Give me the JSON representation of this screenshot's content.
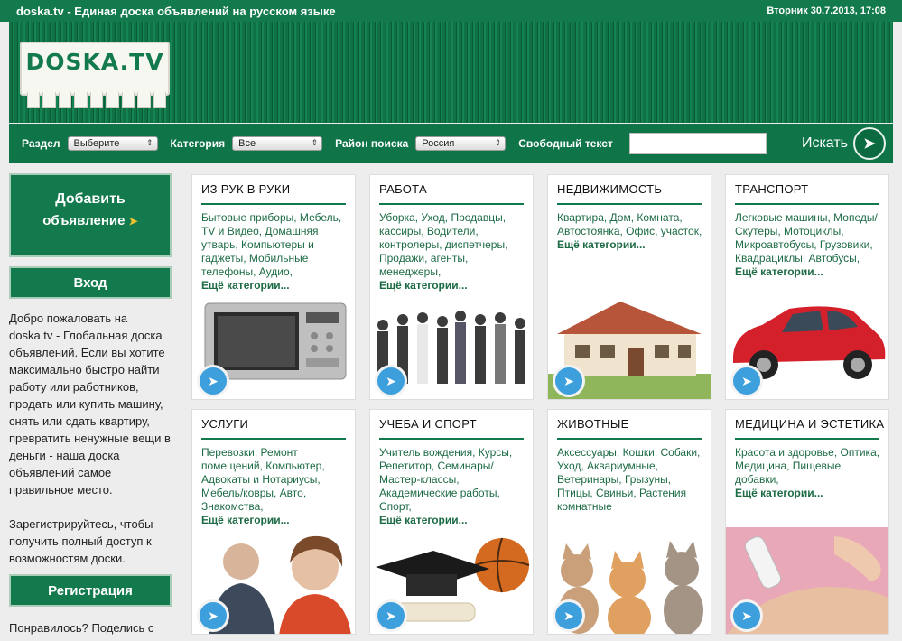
{
  "topbar": {
    "title": "doska.tv - Единая доска объявлений на русском языке",
    "datetime": "Вторник 30.7.2013, 17:08"
  },
  "logo": {
    "text": "DOSKA.TV"
  },
  "search": {
    "section_label": "Раздел",
    "section_value": "Выберите",
    "category_label": "Категория",
    "category_value": "Все",
    "region_label": "Район поиска",
    "region_value": "Россия",
    "freetext_label": "Свободный текст",
    "freetext_value": "",
    "button_label": "Искать"
  },
  "sidebar": {
    "add_line1": "Добавить",
    "add_line2": "объявление",
    "login_label": "Вход",
    "welcome_text": "Добро пожаловать на doska.tv - Глобальная доска объявлений. Если вы хотите максимально быстро найти работу или работников, продать или купить машину, снять или сдать квартиру, превратить ненужные вещи в деньги - наша доска объявлений самое правильное место.",
    "register_prompt": "Зарегистрируйтесь, чтобы получить полный доступ к возможностям доски.",
    "register_label": "Регистрация",
    "share_text": "Понравилось? Поделись с"
  },
  "cards": [
    {
      "title": "ИЗ РУК В РУКИ",
      "links": "Бытовые приборы, Мебель, TV и Видео, Домашняя утварь, Компьютеры и гаджеты, Мобильные телефоны, Аудио,",
      "more": "Ещё категории...",
      "image": "microwave"
    },
    {
      "title": "РАБОТА",
      "links": "Уборка, Уход, Продавцы, кассиры, Водители, контролеры, диспетчеры, Продажи, агенты, менеджеры,",
      "more": "Ещё категории...",
      "image": "people-group"
    },
    {
      "title": "НЕДВИЖИМОСТЬ",
      "links": "Квартира, Дом, Комната, Автостоянка, Офис, участок,",
      "more": "Ещё категории...",
      "image": "house"
    },
    {
      "title": "ТРАНСПОРТ",
      "links": "Легковые машины, Мопеды/Скутеры, Мотоциклы, Микроавтобусы, Грузовики, Квадрациклы, Автобусы,",
      "more": "Ещё категории...",
      "image": "red-car"
    },
    {
      "title": "УСЛУГИ",
      "links": "Перевозки, Ремонт помещений, Компьютер, Адвокаты и Нотариусы, Мебель/ковры, Авто, Знакомства,",
      "more": "Ещё категории...",
      "image": "call-center"
    },
    {
      "title": "УЧЕБА И СПОРТ",
      "links": "Учитель вождения, Курсы, Репетитор, Семинары/Мастер-классы, Академические работы, Спорт,",
      "more": "Ещё категории...",
      "image": "graduation-cap-ball"
    },
    {
      "title": "ЖИВОТНЫЕ",
      "links": "Аксессуары, Кошки, Собаки, Уход, Аквариумные, Ветеринары, Грызуны, Птицы, Свиньи, Растения комнатные",
      "more": "",
      "image": "kittens"
    },
    {
      "title": "МЕДИЦИНА И ЭСТЕТИКА",
      "links": "Красота и здоровье, Оптика, Медицина, Пищевые добавки,",
      "more": "Ещё категории...",
      "image": "laser-treatment"
    }
  ],
  "colors": {
    "brand_green": "#127a4d",
    "link_green": "#1d6b45",
    "play_blue": "#3d9fdc"
  }
}
